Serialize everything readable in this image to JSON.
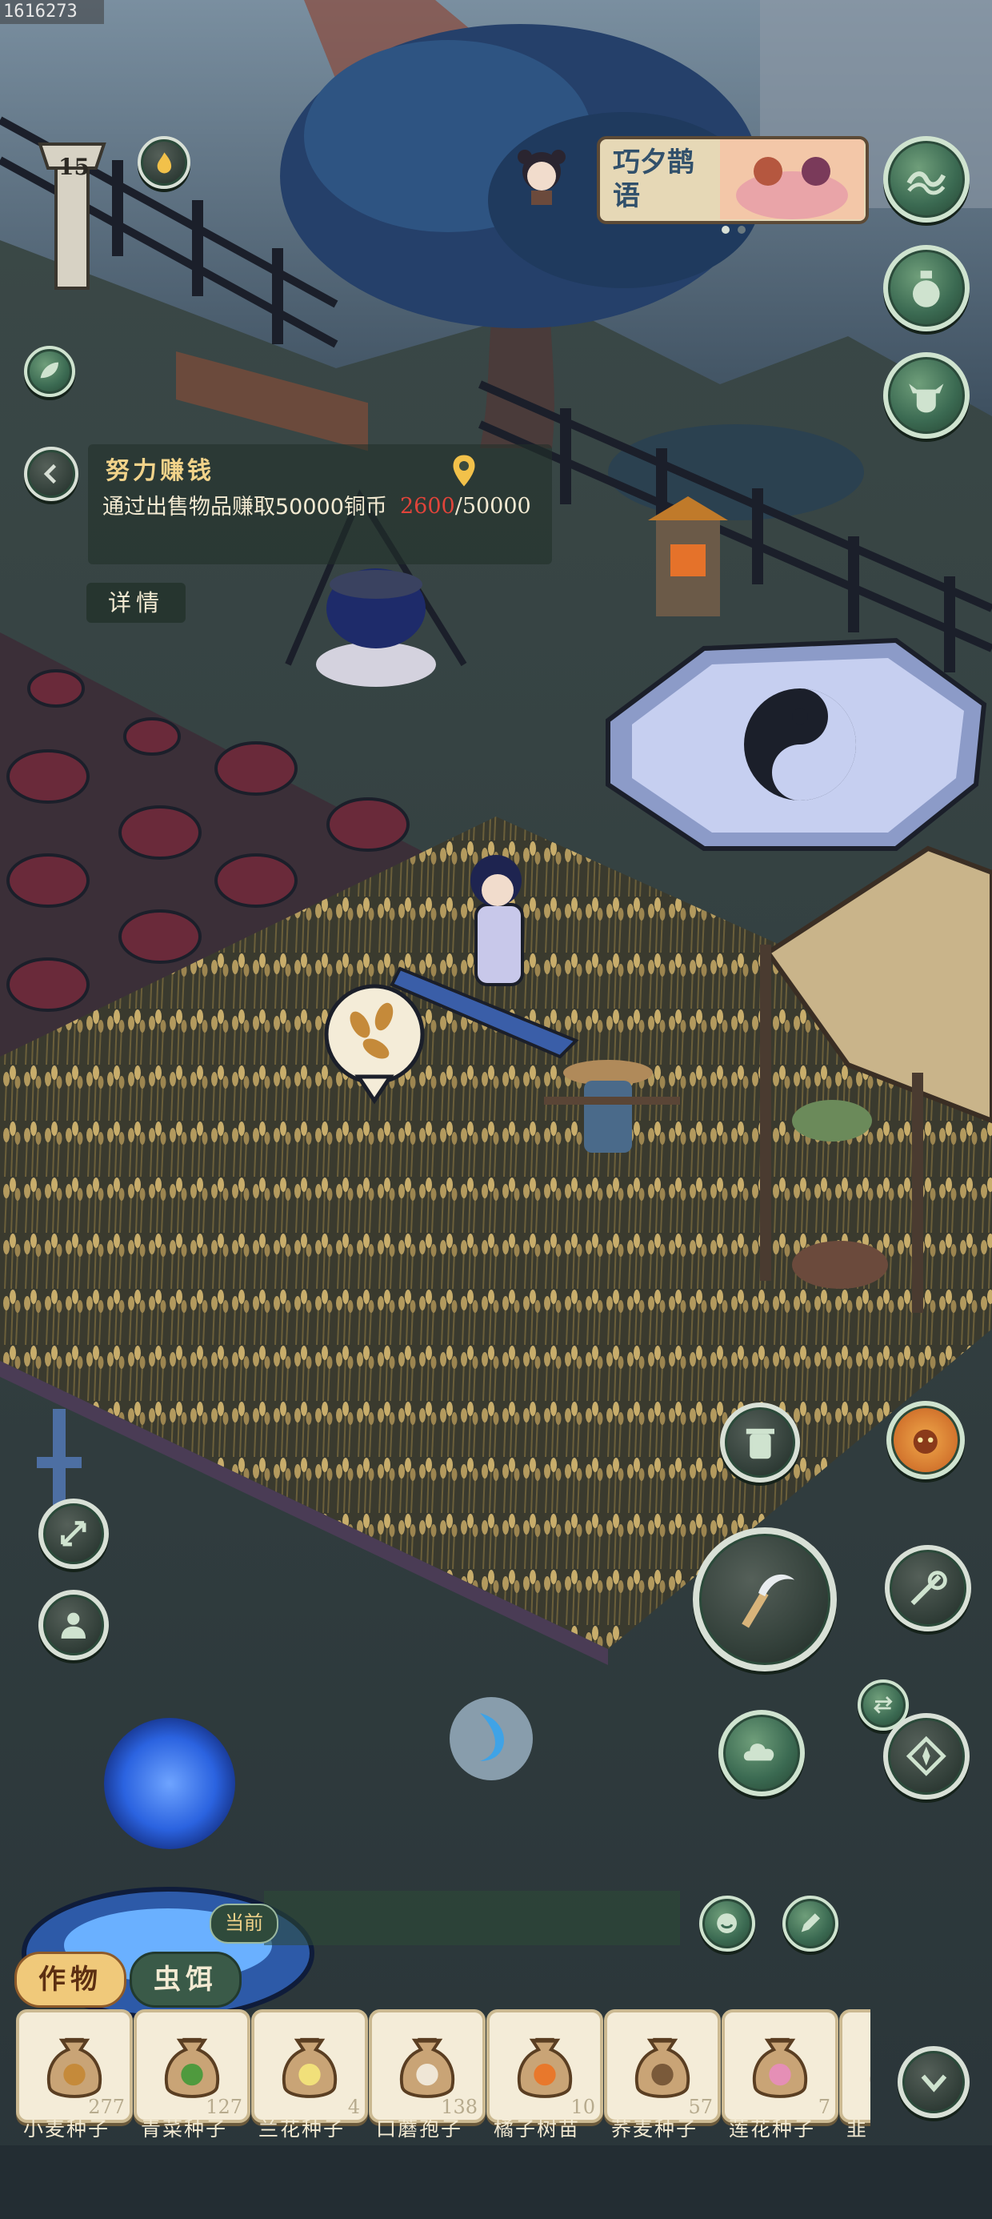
{
  "watermark_id": "1616273",
  "hud": {
    "level": "15",
    "event_banner_text": "巧夕鹊语"
  },
  "quest": {
    "title": "努力赚钱",
    "description": "通过出售物品赚取50000铜币",
    "progress_current": "2600",
    "progress_target": "/50000",
    "detail_label": "详情"
  },
  "inventory": {
    "current_tag": "当前",
    "tabs": [
      {
        "label": "作物",
        "active": true
      },
      {
        "label": "虫饵",
        "active": false
      }
    ],
    "items": [
      {
        "name": "小麦种子",
        "count": "277",
        "icon": "wheat-seed-bag-icon",
        "accent": "#c58a3a"
      },
      {
        "name": "青菜种子",
        "count": "127",
        "icon": "greens-seed-bag-icon",
        "accent": "#4f9a3e"
      },
      {
        "name": "兰花种子",
        "count": "4",
        "icon": "orchid-seed-bag-icon",
        "accent": "#f1e07a"
      },
      {
        "name": "口蘑孢子",
        "count": "138",
        "icon": "mushroom-spore-bag-icon",
        "accent": "#efe6d6"
      },
      {
        "name": "橘子树苗",
        "count": "10",
        "icon": "orange-sapling-bag-icon",
        "accent": "#e8782c"
      },
      {
        "name": "荞麦种子",
        "count": "57",
        "icon": "buckwheat-seed-bag-icon",
        "accent": "#7a5a3a"
      },
      {
        "name": "莲花种子",
        "count": "7",
        "icon": "lotus-seed-bag-icon",
        "accent": "#e58fb6"
      },
      {
        "name": "韭",
        "count": "",
        "icon": "leek-seed-bag-icon",
        "accent": "#6aa04a"
      }
    ]
  },
  "colors": {
    "accent_gold": "#f0c97a",
    "progress_red": "#e0443a",
    "button_green": "#3b6a52"
  }
}
